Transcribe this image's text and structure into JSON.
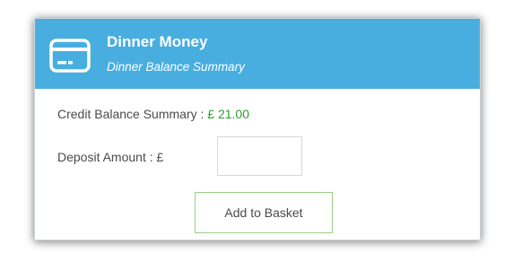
{
  "panel": {
    "icon": "credit-card-icon",
    "title": "Dinner Money",
    "subtitle": "Dinner Balance Summary"
  },
  "balance": {
    "label": "Credit Balance Summary : ",
    "value": "£ 21.00"
  },
  "deposit": {
    "label": "Deposit Amount : £",
    "value": "",
    "placeholder": ""
  },
  "actions": {
    "add_to_basket": "Add to Basket"
  },
  "colors": {
    "header": "#48aee0",
    "balance_value": "#2c9b2c",
    "button_border": "#9bcf86"
  }
}
